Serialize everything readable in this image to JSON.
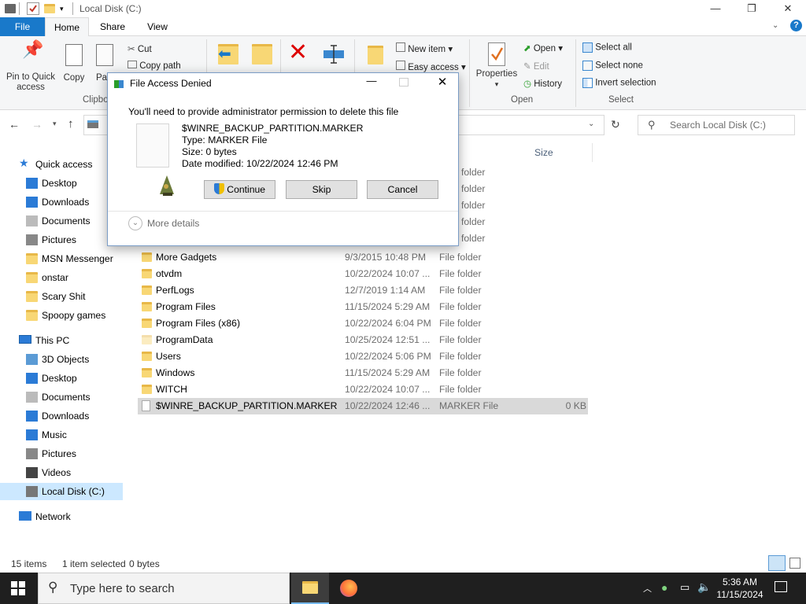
{
  "window": {
    "title": "Local Disk (C:)"
  },
  "tabs": {
    "file": "File",
    "home": "Home",
    "share": "Share",
    "view": "View"
  },
  "ribbon": {
    "pin_label_1": "Pin to Quick",
    "pin_label_2": "access",
    "copy": "Copy",
    "paste": "Pa",
    "cut": "Cut",
    "copy_path": "Copy path",
    "clipboard_group": "Clipbo",
    "new_item": "New item",
    "easy_access": "Easy access",
    "properties": "Properties",
    "open": "Open",
    "edit": "Edit",
    "history": "History",
    "open_group": "Open",
    "select_all": "Select all",
    "select_none": "Select none",
    "invert_selection": "Invert selection",
    "select_group": "Select"
  },
  "search": {
    "placeholder": "Search Local Disk (C:)"
  },
  "columns": {
    "size": "Size"
  },
  "nav": {
    "quick_access": "Quick access",
    "qa_items": [
      "Desktop",
      "Downloads",
      "Documents",
      "Pictures",
      "MSN Messenger",
      "onstar",
      "Scary Shit",
      "Spoopy games"
    ],
    "this_pc": "This PC",
    "pc_items": [
      "3D Objects",
      "Desktop",
      "Documents",
      "Downloads",
      "Music",
      "Pictures",
      "Videos",
      "Local Disk (C:)"
    ],
    "network": "Network"
  },
  "hidden_rows_type": [
    "folder",
    "folder",
    "folder",
    "folder",
    "folder"
  ],
  "files": [
    {
      "name": "More Gadgets",
      "date": "9/3/2015 10:48 PM",
      "type": "File folder",
      "size": ""
    },
    {
      "name": "otvdm",
      "date": "10/22/2024 10:07 ...",
      "type": "File folder",
      "size": ""
    },
    {
      "name": "PerfLogs",
      "date": "12/7/2019 1:14 AM",
      "type": "File folder",
      "size": ""
    },
    {
      "name": "Program Files",
      "date": "11/15/2024 5:29 AM",
      "type": "File folder",
      "size": ""
    },
    {
      "name": "Program Files (x86)",
      "date": "10/22/2024 6:04 PM",
      "type": "File folder",
      "size": ""
    },
    {
      "name": "ProgramData",
      "date": "10/25/2024 12:51 ...",
      "type": "File folder",
      "size": ""
    },
    {
      "name": "Users",
      "date": "10/22/2024 5:06 PM",
      "type": "File folder",
      "size": ""
    },
    {
      "name": "Windows",
      "date": "11/15/2024 5:29 AM",
      "type": "File folder",
      "size": ""
    },
    {
      "name": "WITCH",
      "date": "10/22/2024 10:07 ...",
      "type": "File folder",
      "size": ""
    },
    {
      "name": "$WINRE_BACKUP_PARTITION.MARKER",
      "date": "10/22/2024 12:46 ...",
      "type": "MARKER File",
      "size": "0 KB"
    }
  ],
  "status": {
    "count": "15 items",
    "selected": "1 item selected",
    "sel_size": "0 bytes"
  },
  "dialog": {
    "title": "File Access Denied",
    "message": "You'll need to provide administrator permission to delete this file",
    "file_name": "$WINRE_BACKUP_PARTITION.MARKER",
    "file_type": "Type: MARKER File",
    "file_size": "Size: 0 bytes",
    "file_date": "Date modified: 10/22/2024 12:46 PM",
    "continue": "Continue",
    "skip": "Skip",
    "cancel": "Cancel",
    "more_details": "More details"
  },
  "taskbar": {
    "search_placeholder": "Type here to search",
    "time": "5:36 AM",
    "date": "11/15/2024"
  },
  "colors": {
    "accent": "#1979ca",
    "selection": "#d9d9d9",
    "folder": "#f8d775",
    "taskbar": "#1f1f1f"
  }
}
